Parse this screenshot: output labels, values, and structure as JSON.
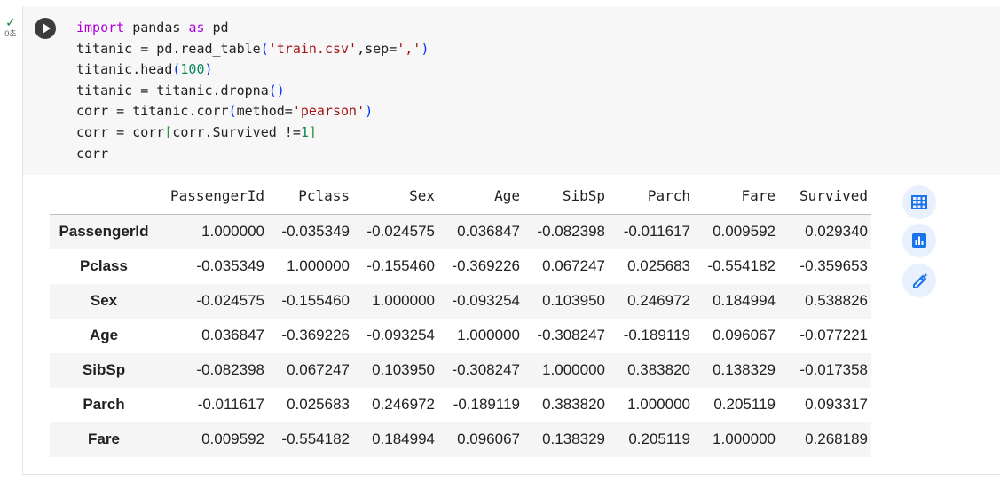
{
  "cell_status": {
    "check_glyph": "✓",
    "exec_time": "0초"
  },
  "code_lines": [
    "import pandas as pd",
    "titanic = pd.read_table('train.csv',sep=',')",
    "titanic.head(100)",
    "titanic = titanic.dropna()",
    "corr = titanic.corr(method='pearson')",
    "corr = corr[corr.Survived !=1]",
    "corr"
  ],
  "table": {
    "columns": [
      "PassengerId",
      "Pclass",
      "Sex",
      "Age",
      "SibSp",
      "Parch",
      "Fare",
      "Survived"
    ],
    "rows": [
      {
        "index": "PassengerId",
        "values": [
          "1.000000",
          "-0.035349",
          "-0.024575",
          "0.036847",
          "-0.082398",
          "-0.011617",
          "0.009592",
          "0.029340"
        ]
      },
      {
        "index": "Pclass",
        "values": [
          "-0.035349",
          "1.000000",
          "-0.155460",
          "-0.369226",
          "0.067247",
          "0.025683",
          "-0.554182",
          "-0.359653"
        ]
      },
      {
        "index": "Sex",
        "values": [
          "-0.024575",
          "-0.155460",
          "1.000000",
          "-0.093254",
          "0.103950",
          "0.246972",
          "0.184994",
          "0.538826"
        ]
      },
      {
        "index": "Age",
        "values": [
          "0.036847",
          "-0.369226",
          "-0.093254",
          "1.000000",
          "-0.308247",
          "-0.189119",
          "0.096067",
          "-0.077221"
        ]
      },
      {
        "index": "SibSp",
        "values": [
          "-0.082398",
          "0.067247",
          "0.103950",
          "-0.308247",
          "1.000000",
          "0.383820",
          "0.138329",
          "-0.017358"
        ]
      },
      {
        "index": "Parch",
        "values": [
          "-0.011617",
          "0.025683",
          "0.246972",
          "-0.189119",
          "0.383820",
          "1.000000",
          "0.205119",
          "0.093317"
        ]
      },
      {
        "index": "Fare",
        "values": [
          "0.009592",
          "-0.554182",
          "0.184994",
          "0.096067",
          "0.138329",
          "0.205119",
          "1.000000",
          "0.268189"
        ]
      }
    ]
  },
  "side_actions": [
    {
      "icon": "table-icon"
    },
    {
      "icon": "bar-chart-icon"
    },
    {
      "icon": "magic-pen-icon"
    }
  ],
  "colors": {
    "keyword": "#af00db",
    "string": "#a31515",
    "number": "#098658",
    "accent": "#1a73e8"
  }
}
